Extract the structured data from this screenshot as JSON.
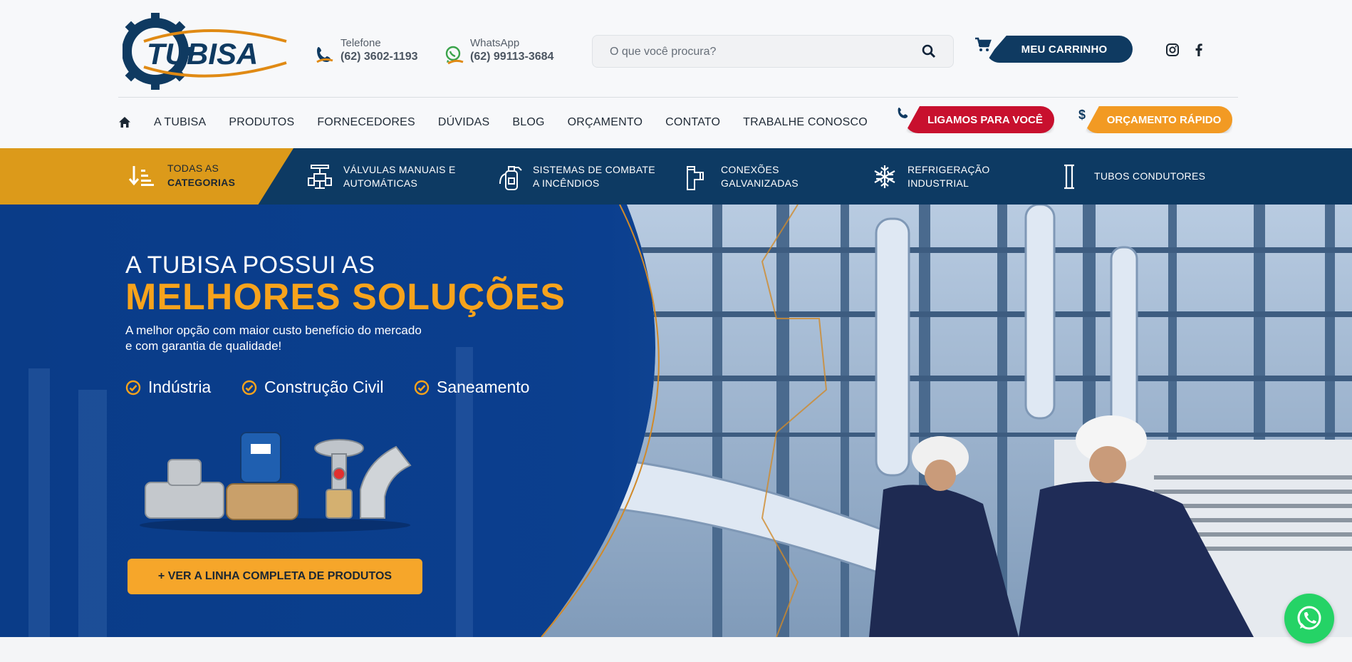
{
  "header": {
    "logo_text": "TUBISA",
    "phone": {
      "label": "Telefone",
      "value": "(62) 3602-1193"
    },
    "whatsapp": {
      "label": "WhatsApp",
      "value": "(62) 99113-3684"
    },
    "search": {
      "placeholder": "O que você procura?"
    },
    "cart_label": "MEU CARRINHO",
    "social": [
      "instagram-icon",
      "facebook-icon"
    ]
  },
  "nav": {
    "items": [
      "A TUBISA",
      "PRODUTOS",
      "FORNECEDORES",
      "DÚVIDAS",
      "BLOG",
      "ORÇAMENTO",
      "CONTATO",
      "TRABALHE CONOSCO"
    ],
    "call_label": "LIGAMOS PARA VOCÊ",
    "quote_label": "ORÇAMENTO RÁPIDO"
  },
  "categories": {
    "all_line1": "TODAS AS",
    "all_line2": "CATEGORIAS",
    "items": [
      {
        "label": "VÁLVULAS MANUAIS E\nAUTOMÁTICAS",
        "icon": "valve-icon"
      },
      {
        "label": "SISTEMAS DE COMBATE\nA INCÊNDIOS",
        "icon": "fire-extinguisher-icon"
      },
      {
        "label": "CONEXÕES\nGALVANIZADAS",
        "icon": "pipe-fitting-icon"
      },
      {
        "label": "REFRIGERAÇÃO\nINDUSTRIAL",
        "icon": "snowflake-icon"
      },
      {
        "label": "TUBOS CONDUTORES",
        "icon": "tube-icon"
      }
    ]
  },
  "hero": {
    "title_small": "A TUBISA POSSUI AS",
    "title_big": "MELHORES SOLUÇÕES",
    "desc_line1": "A melhor opção com maior custo benefício do mercado",
    "desc_line2": "e com garantia de qualidade!",
    "features": [
      "Indústria",
      "Construção Civil",
      "Saneamento"
    ],
    "cta": "+ VER A LINHA COMPLETA DE PRODUTOS"
  },
  "colors": {
    "navy": "#0d3a63",
    "orange": "#f7a31c",
    "red": "#c8102e",
    "hero_blue": "#0a3f8c",
    "whatsapp_green": "#25d366"
  }
}
